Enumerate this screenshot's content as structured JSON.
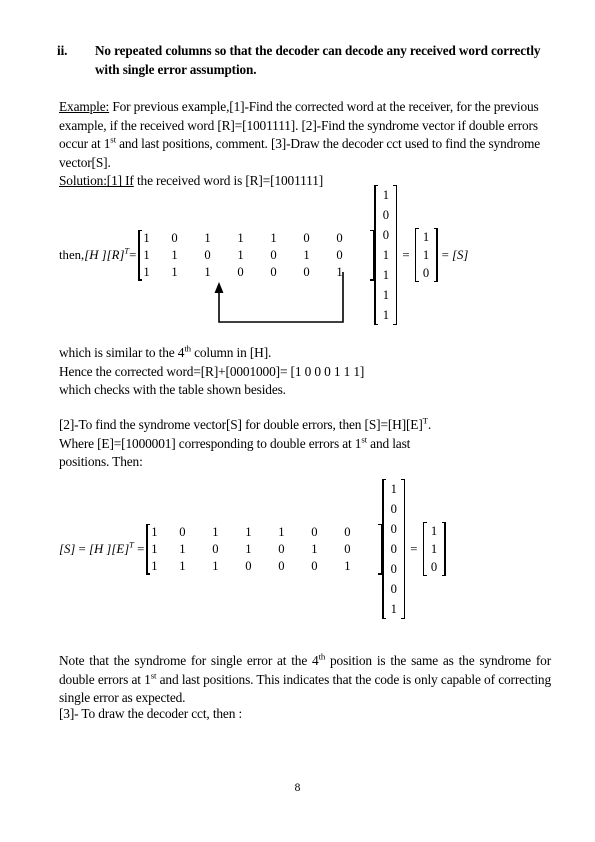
{
  "document": {
    "page_number": "8"
  },
  "item_ii": {
    "marker": "ii.",
    "text": "No repeated columns so that the decoder can decode any received word correctly with single error assumption."
  },
  "example": {
    "label": "Example:",
    "line1": " For previous example,[1]-Find the corrected word at the receiver, for the previous example, if the received word [R]=[1001111]. [2]-Find the syndrome vector if double errors occur at 1",
    "sup_st": "st",
    "line1b": " and last positions, comment.  [3]-Draw the decoder cct used to find the syndrome vector[S].",
    "solution_label": "Solution:[1] If",
    "solution_rest": " the received word is [R]=[1001111]"
  },
  "equation1": {
    "lhs_prefix": "then,",
    "lhs_H": "[H ]",
    "lhs_R": "[R]",
    "lhs_T": "T",
    "lhs_eq": "=",
    "H_matrix": [
      [
        "1",
        "0",
        "1",
        "1",
        "1",
        "0",
        "0"
      ],
      [
        "1",
        "1",
        "0",
        "1",
        "0",
        "1",
        "0"
      ],
      [
        "1",
        "1",
        "1",
        "0",
        "0",
        "0",
        "1"
      ]
    ],
    "R_vector": [
      "1",
      "0",
      "0",
      "1",
      "1",
      "1",
      "1"
    ],
    "operator": "=",
    "S_vector": [
      "1",
      "1",
      "0"
    ],
    "tail_eq": "=",
    "tail_S": "[S]"
  },
  "which_para": {
    "line1_a": "which is similar to the 4",
    "line1_sup": "th",
    "line1_b": " column in [H].",
    "line2": "Hence the corrected word=[R]+[0001000]= [1 0 0 0 1 1 1]",
    "line3": "which checks with the table shown besides."
  },
  "part2": {
    "line1_a": "[2]-To find the syndrome vector[S] for double errors, then [S]=[H][E]",
    "line1_sup": "T",
    "line1_b": ".",
    "line2_a": "Where [E]=[1000001] corresponding to double errors at 1",
    "line2_sup": "st",
    "line2_b": " and last",
    "line3": "positions. Then:"
  },
  "equation2": {
    "lhs_S": "[S]",
    "lhs_eq1": " = ",
    "lhs_H": "[H ]",
    "lhs_E": "[E]",
    "lhs_T": "T",
    "lhs_eq2": " = ",
    "H_matrix": [
      [
        "1",
        "0",
        "1",
        "1",
        "1",
        "0",
        "0"
      ],
      [
        "1",
        "1",
        "0",
        "1",
        "0",
        "1",
        "0"
      ],
      [
        "1",
        "1",
        "1",
        "0",
        "0",
        "0",
        "1"
      ]
    ],
    "E_vector": [
      "1",
      "0",
      "0",
      "0",
      "0",
      "0",
      "1"
    ],
    "operator": "=",
    "S_vector": [
      "1",
      "1",
      "0"
    ]
  },
  "note_para": {
    "line1_a": "Note that the syndrome for single error at the 4",
    "line1_sup": "th",
    "line1_b": " position is the same as the syndrome for double errors at 1",
    "line2_sup": "st",
    "line2_b": " and last positions. This indicates that the code is only capable of correcting single error as expected."
  },
  "part3": {
    "text": "[3]- To draw the decoder cct, then :"
  }
}
